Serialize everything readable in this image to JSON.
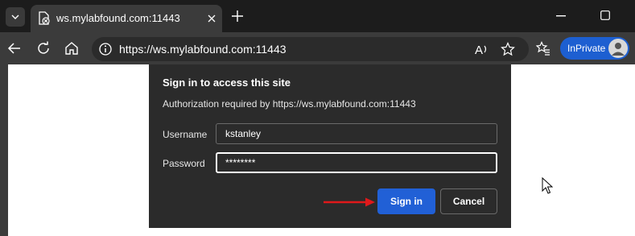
{
  "browser": {
    "tab": {
      "title": "ws.mylabfound.com:11443",
      "favicon": "page-error-icon"
    },
    "url": "https://ws.mylabfound.com:11443",
    "inprivate_label": "InPrivate",
    "icons": [
      "tab-list-icon",
      "close-icon",
      "plus-icon",
      "minimize-icon",
      "maximize-icon",
      "back-icon",
      "refresh-icon",
      "home-icon",
      "info-icon",
      "read-aloud-icon",
      "star-icon",
      "favorites-icon",
      "avatar-icon"
    ]
  },
  "dialog": {
    "title": "Sign in to access this site",
    "subtitle": "Authorization required by https://ws.mylabfound.com:11443",
    "username_label": "Username",
    "username_value": "kstanley",
    "password_label": "Password",
    "password_value": "********",
    "sign_in_label": "Sign in",
    "cancel_label": "Cancel"
  },
  "colors": {
    "accent": "#2160d6",
    "annotation_arrow": "#e0191b",
    "dialog_bg": "#2b2b2b"
  }
}
